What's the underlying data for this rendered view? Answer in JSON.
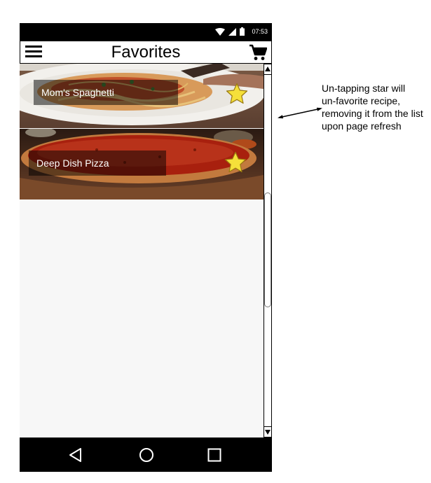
{
  "status_bar": {
    "time": "07:53"
  },
  "app_bar": {
    "title": "Favorites"
  },
  "favorites": [
    {
      "name": "Mom's Spaghetti",
      "favorited": true
    },
    {
      "name": "Deep Dish Pizza",
      "favorited": true
    }
  ],
  "annotation": {
    "text": "Un-tapping star will\nun-favorite recipe,\nremoving it from the list\nupon page refresh"
  },
  "colors": {
    "star_fill": "#f5e03a",
    "star_stroke": "#b08a00",
    "bar_black": "#000000"
  }
}
